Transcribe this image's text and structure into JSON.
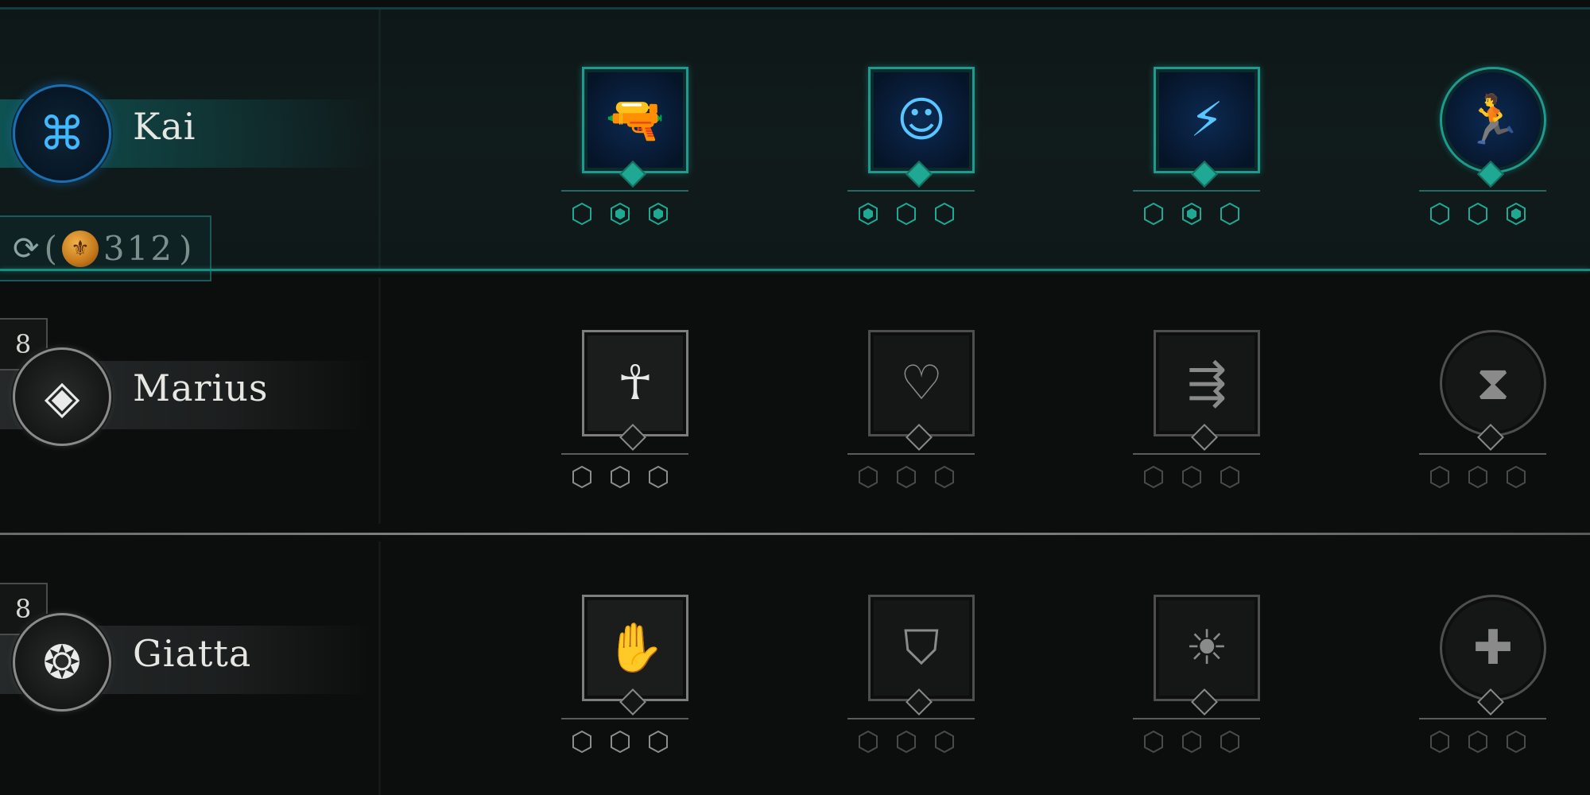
{
  "colors": {
    "accent_teal": "#1fa893",
    "selected_glyph_blue": "#58c6ff",
    "inactive_border": "#7d7d7d",
    "background": "#0c0d0d",
    "coin_gold": "#e8a03a"
  },
  "respec": {
    "icon": "refresh-icon",
    "coin_icon": "fleur-coin-icon",
    "open_paren": "(",
    "cost": "312",
    "close_paren": ")"
  },
  "characters": [
    {
      "name": "Kai",
      "selected": true,
      "level": "",
      "portrait_icon": "knot-emblem-icon",
      "skills": [
        {
          "icon": "gunner-icon",
          "shape": "square",
          "pips": [
            false,
            true,
            true
          ]
        },
        {
          "icon": "mask-face-icon",
          "shape": "square",
          "pips": [
            true,
            false,
            false
          ]
        },
        {
          "icon": "leap-strike-icon",
          "shape": "square",
          "pips": [
            false,
            true,
            false
          ]
        },
        {
          "icon": "sprint-icon",
          "shape": "round",
          "pips": [
            false,
            false,
            true
          ]
        }
      ]
    },
    {
      "name": "Marius",
      "selected": false,
      "level": "8",
      "portrait_icon": "diamond-emblem-icon",
      "skills": [
        {
          "icon": "rising-figure-icon",
          "shape": "square",
          "dim": false,
          "pips": [
            false,
            false,
            false
          ]
        },
        {
          "icon": "heart-target-icon",
          "shape": "square",
          "dim": true,
          "pips": [
            false,
            false,
            false
          ]
        },
        {
          "icon": "push-figure-icon",
          "shape": "square",
          "dim": true,
          "pips": [
            false,
            false,
            false
          ]
        },
        {
          "icon": "hourglass-burst-icon",
          "shape": "round",
          "dim": true,
          "pips": [
            false,
            false,
            false
          ]
        }
      ]
    },
    {
      "name": "Giatta",
      "selected": false,
      "level": "8",
      "portrait_icon": "drop-emblem-icon",
      "skills": [
        {
          "icon": "healing-hand-icon",
          "shape": "square",
          "dim": false,
          "pips": [
            false,
            false,
            false
          ]
        },
        {
          "icon": "group-shield-icon",
          "shape": "square",
          "dim": true,
          "pips": [
            false,
            false,
            false
          ]
        },
        {
          "icon": "rally-sun-icon",
          "shape": "square",
          "dim": true,
          "pips": [
            false,
            false,
            false
          ]
        },
        {
          "icon": "syringe-heart-icon",
          "shape": "round",
          "dim": true,
          "pips": [
            false,
            false,
            false
          ]
        }
      ]
    }
  ]
}
